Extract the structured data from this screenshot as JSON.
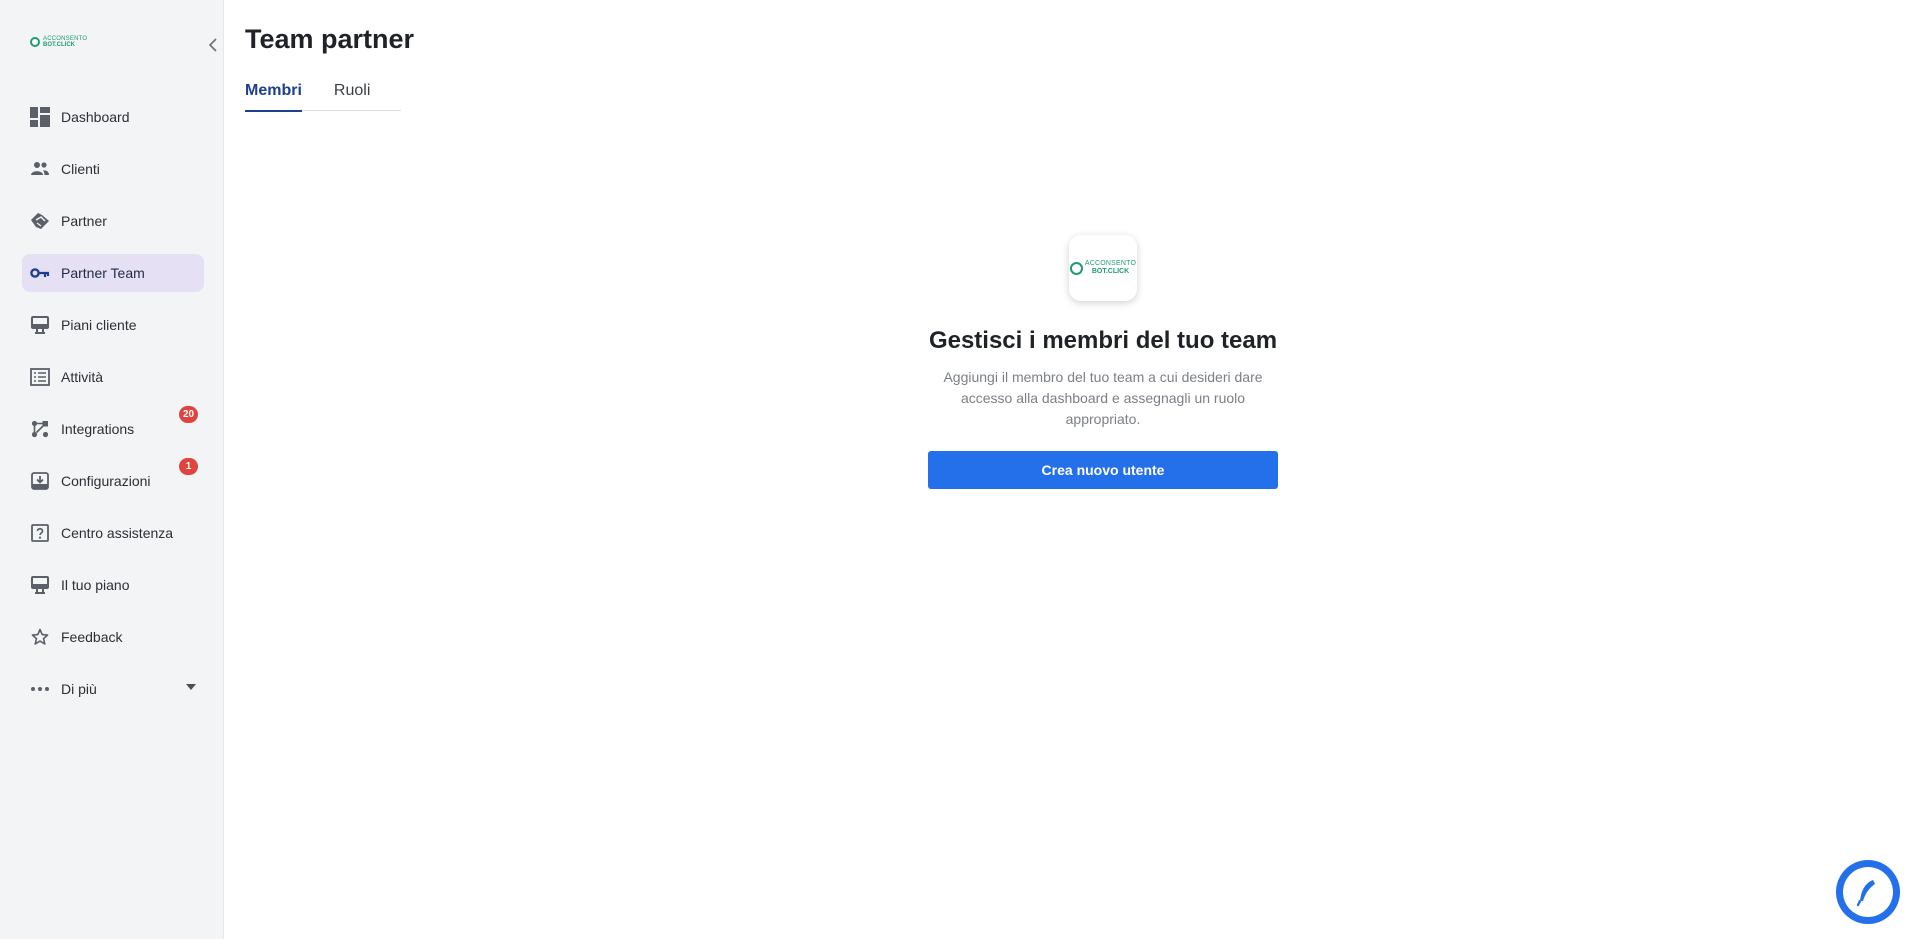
{
  "brand": {
    "logo_line1": "ACCONSENTO",
    "logo_line2": "BOT.CLICK",
    "primary_color": "#2470ea",
    "brand_green": "#1f9c74"
  },
  "sidebar": {
    "items": [
      {
        "label": "Dashboard",
        "icon": "dashboard-icon"
      },
      {
        "label": "Clienti",
        "icon": "people-icon"
      },
      {
        "label": "Partner",
        "icon": "handshake-icon"
      },
      {
        "label": "Partner Team",
        "icon": "key-icon",
        "active": true
      },
      {
        "label": "Piani cliente",
        "icon": "plan-icon"
      },
      {
        "label": "Attività",
        "icon": "list-icon"
      },
      {
        "label": "Integrations",
        "icon": "integrations-icon",
        "badge": "20"
      },
      {
        "label": "Configurazioni",
        "icon": "config-icon",
        "badge": "1"
      },
      {
        "label": "Centro assistenza",
        "icon": "help-icon"
      },
      {
        "label": "Il tuo piano",
        "icon": "plan-icon"
      },
      {
        "label": "Feedback",
        "icon": "star-icon"
      },
      {
        "label": "Di più",
        "icon": "more-icon"
      }
    ]
  },
  "main": {
    "title": "Team partner",
    "tabs": [
      {
        "label": "Membri",
        "active": true
      },
      {
        "label": "Ruoli"
      }
    ],
    "empty_state": {
      "title": "Gestisci i membri del tuo team",
      "description": "Aggiungi il membro del tuo team a cui desideri dare accesso alla dashboard e assegnagli un ruolo appropriato.",
      "button_label": "Crea nuovo utente"
    }
  }
}
